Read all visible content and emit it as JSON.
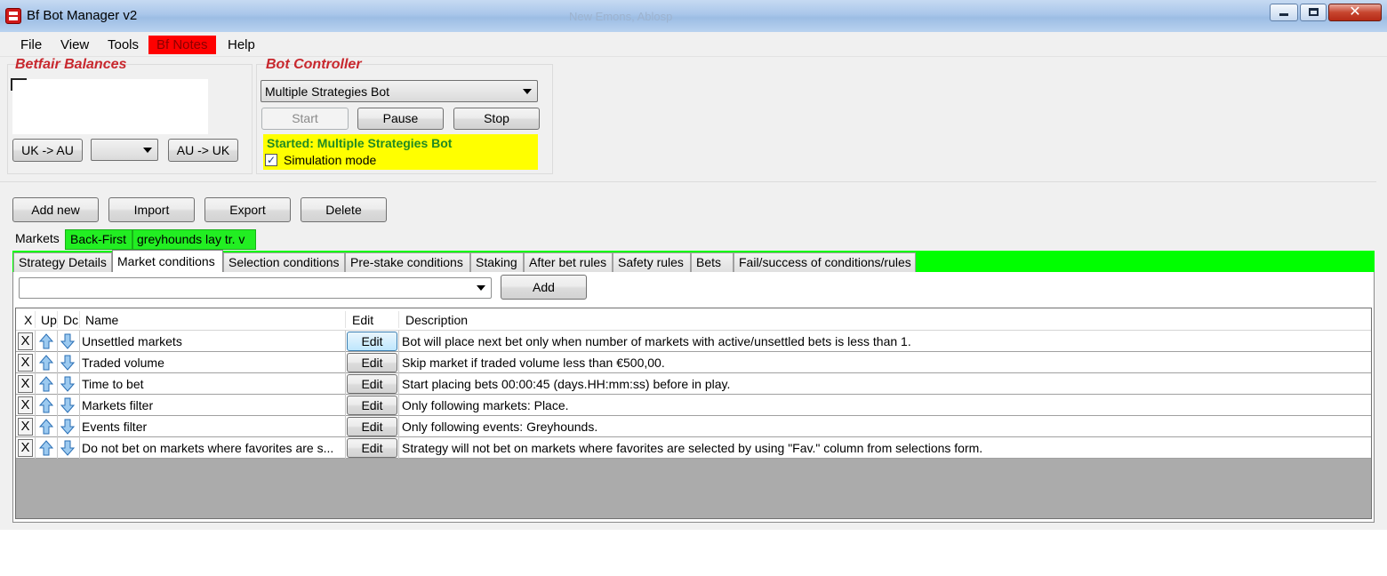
{
  "window": {
    "title": "Bf Bot Manager v2",
    "background_title": "New Emons, Ablosp"
  },
  "menu": {
    "items": [
      "File",
      "View",
      "Tools",
      "Bf Notes",
      "Help"
    ],
    "highlight_color": "#ff0000"
  },
  "balances": {
    "label": "Betfair Balances",
    "uk_to_au_label": "UK -> AU",
    "au_to_uk_label": "AU -> UK",
    "dropdown_value": ""
  },
  "bot_controller": {
    "label": "Bot Controller",
    "selected_bot": "Multiple Strategies Bot",
    "start_label": "Start",
    "pause_label": "Pause",
    "stop_label": "Stop",
    "status_text": "Started: Multiple Strategies Bot",
    "simulation_label": "Simulation mode",
    "simulation_checked": true,
    "status_color": "#ffff00"
  },
  "toolbar": {
    "add_new_label": "Add new",
    "import_label": "Import",
    "export_label": "Export",
    "delete_label": "Delete"
  },
  "strategy_tabs": {
    "markets_label": "Markets",
    "tabs": [
      "Back-First",
      "greyhounds lay tr. v"
    ],
    "accent_color": "#00ff00"
  },
  "sub_tabs": [
    "Strategy Details",
    "Market conditions",
    "Selection conditions",
    "Pre-stake conditions",
    "Staking",
    "After bet rules",
    "Safety rules",
    "Bets",
    "Fail/success of conditions/rules"
  ],
  "active_sub_tab": "Market conditions",
  "condition_picker": {
    "value": "",
    "add_label": "Add"
  },
  "grid": {
    "headers": {
      "x": "X",
      "up": "Up",
      "down": "Dc",
      "name": "Name",
      "edit": "Edit",
      "description": "Description"
    },
    "rows": [
      {
        "x": "X",
        "name": "Unsettled markets",
        "edit": "Edit",
        "description": "Bot will place next bet only when number of markets with active/unsettled bets is less than 1."
      },
      {
        "x": "X",
        "name": "Traded volume",
        "edit": "Edit",
        "description": "Skip market if traded volume less than €500,00."
      },
      {
        "x": "X",
        "name": "Time to bet",
        "edit": "Edit",
        "description": "Start placing bets 00:00:45 (days.HH:mm:ss) before in play."
      },
      {
        "x": "X",
        "name": "Markets filter",
        "edit": "Edit",
        "description": "Only following markets: Place."
      },
      {
        "x": "X",
        "name": "Events filter",
        "edit": "Edit",
        "description": "Only following events: Greyhounds."
      },
      {
        "x": "X",
        "name": "Do not bet on markets where favorites are s...",
        "edit": "Edit",
        "description": "Strategy will not bet on markets where favorites are selected by using \"Fav.\" column from selections form."
      }
    ]
  }
}
